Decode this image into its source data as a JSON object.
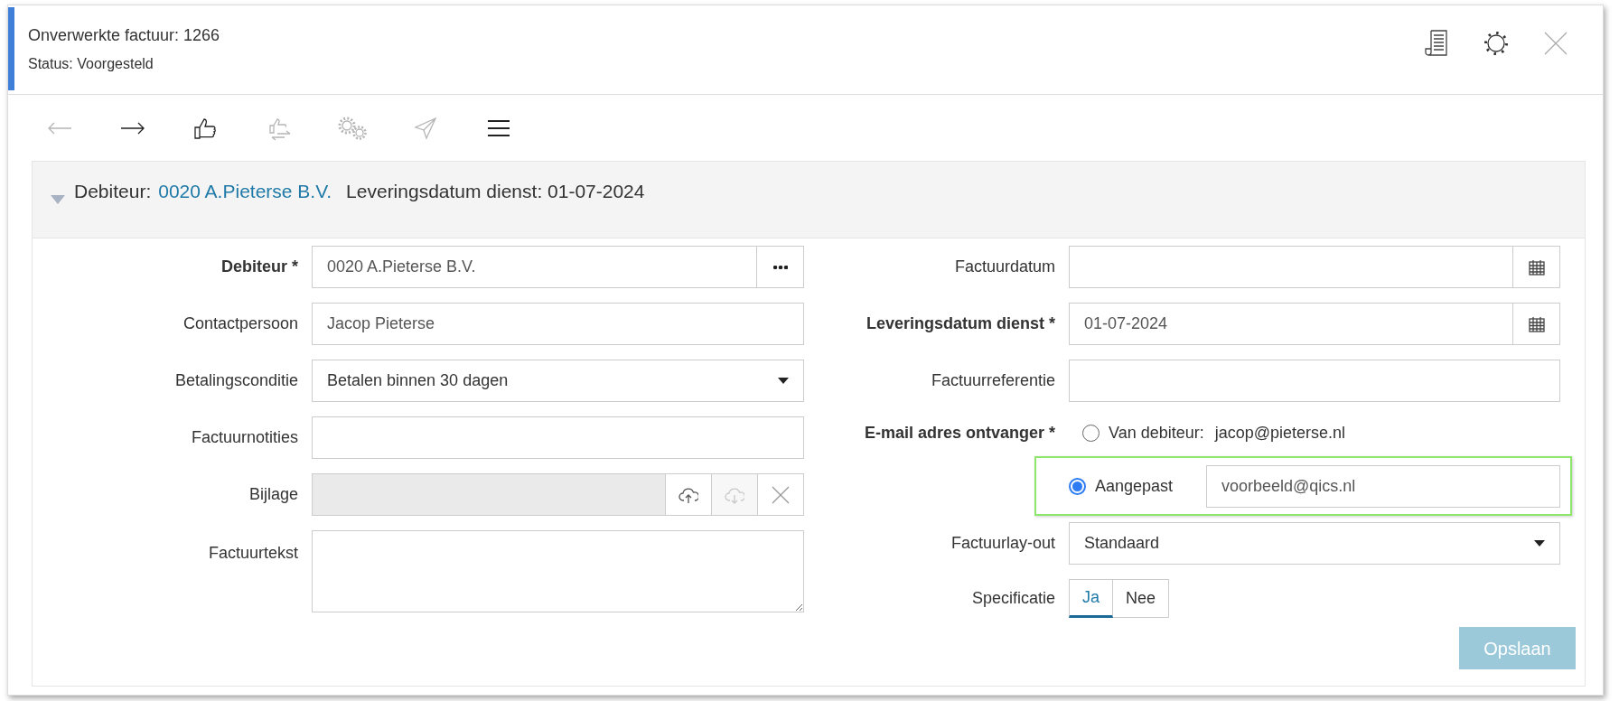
{
  "window": {
    "title": "Onverwerkte factuur: 1266",
    "status": "Status: Voorgesteld"
  },
  "toolbar": [
    {
      "kind": "back",
      "disabled": true
    },
    {
      "kind": "forward",
      "disabled": false
    },
    {
      "kind": "approve",
      "disabled": false
    },
    {
      "kind": "reassign",
      "disabled": true
    },
    {
      "kind": "process",
      "disabled": true
    },
    {
      "kind": "send",
      "disabled": true
    },
    {
      "kind": "menu",
      "disabled": false
    }
  ],
  "section": {
    "expanded": true,
    "summary": {
      "label": "Debiteur:",
      "link": "0020 A.Pieterse B.V.",
      "detail": "Leveringsdatum dienst: 01-07-2024"
    },
    "left_fields": [
      {
        "kind": "lookup",
        "label": "Debiteur *",
        "required": true,
        "value": "0020 A.Pieterse B.V."
      },
      {
        "kind": "text",
        "label": "Contactpersoon",
        "required": false,
        "value": "Jacop Pieterse"
      },
      {
        "kind": "select",
        "label": "Betalingsconditie",
        "required": false,
        "value": "Betalen binnen 30 dagen"
      },
      {
        "kind": "text",
        "label": "Factuurnotities",
        "required": false
      },
      {
        "kind": "attachment",
        "label": "Bijlage",
        "required": false,
        "buttons": [
          {
            "kind": "upload",
            "disabled": false
          },
          {
            "kind": "download",
            "disabled": true
          },
          {
            "kind": "clear",
            "disabled": false
          }
        ]
      },
      {
        "kind": "textarea",
        "label": "Factuurtekst",
        "required": false
      }
    ],
    "right_fields": [
      {
        "kind": "date",
        "label": "Factuurdatum",
        "required": false
      },
      {
        "kind": "date",
        "label": "Leveringsdatum dienst *",
        "required": true,
        "value": "01-07-2024"
      },
      {
        "kind": "text",
        "label": "Factuurreferentie",
        "required": false
      },
      {
        "kind": "email_choice",
        "label": "E-mail adres ontvanger *",
        "required": true,
        "options": [
          {
            "kind": "fixed",
            "label": "Van debiteur:",
            "value": "jacop@pieterse.nl",
            "selected": false,
            "highlighted": false
          },
          {
            "kind": "custom",
            "label": "Aangepast",
            "value": "voorbeeld@qics.nl",
            "selected": true,
            "highlighted": true
          }
        ]
      },
      {
        "kind": "select",
        "label": "Factuurlay-out",
        "required": false,
        "value": "Standaard"
      },
      {
        "kind": "toggle",
        "label": "Specificatie",
        "required": false,
        "options": [
          {
            "label": "Ja",
            "selected": true
          },
          {
            "label": "Nee",
            "selected": false
          }
        ]
      }
    ],
    "save_button": {
      "label": "Opslaan",
      "disabled": true
    }
  }
}
